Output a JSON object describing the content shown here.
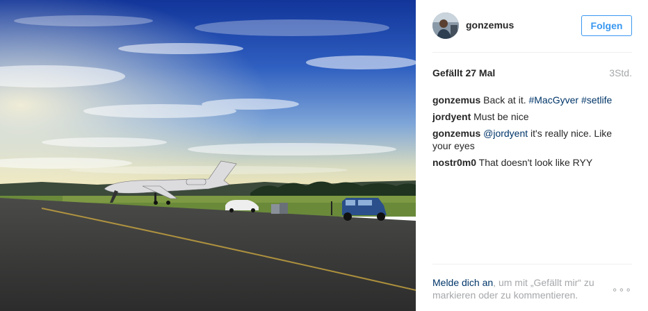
{
  "post": {
    "username": "gonzemus",
    "follow_label": "Folgen",
    "likes": "Gefällt 27 Mal",
    "time": "3Std."
  },
  "comments": [
    {
      "author": "gonzemus",
      "parts": [
        {
          "type": "text",
          "value": "Back at it. "
        },
        {
          "type": "tag",
          "value": "#MacGyver"
        },
        {
          "type": "text",
          "value": " "
        },
        {
          "type": "tag",
          "value": "#setlife"
        }
      ]
    },
    {
      "author": "jordyent",
      "parts": [
        {
          "type": "text",
          "value": "Must be nice"
        }
      ]
    },
    {
      "author": "gonzemus",
      "parts": [
        {
          "type": "mention",
          "value": "@jordyent"
        },
        {
          "type": "text",
          "value": " it's really nice. Like your eyes"
        }
      ]
    },
    {
      "author": "nostr0m0",
      "parts": [
        {
          "type": "text",
          "value": "That doesn't look like RYY"
        }
      ]
    }
  ],
  "footer": {
    "login_link": "Melde dich an",
    "login_rest": ", um mit „Gefällt mir“ zu markieren oder zu kommentieren.",
    "more_icon": "more-options-icon",
    "more_glyph": "∘∘∘"
  },
  "colors": {
    "link": "#003569",
    "button_blue": "#3897f0",
    "muted": "#a5a7aa"
  }
}
